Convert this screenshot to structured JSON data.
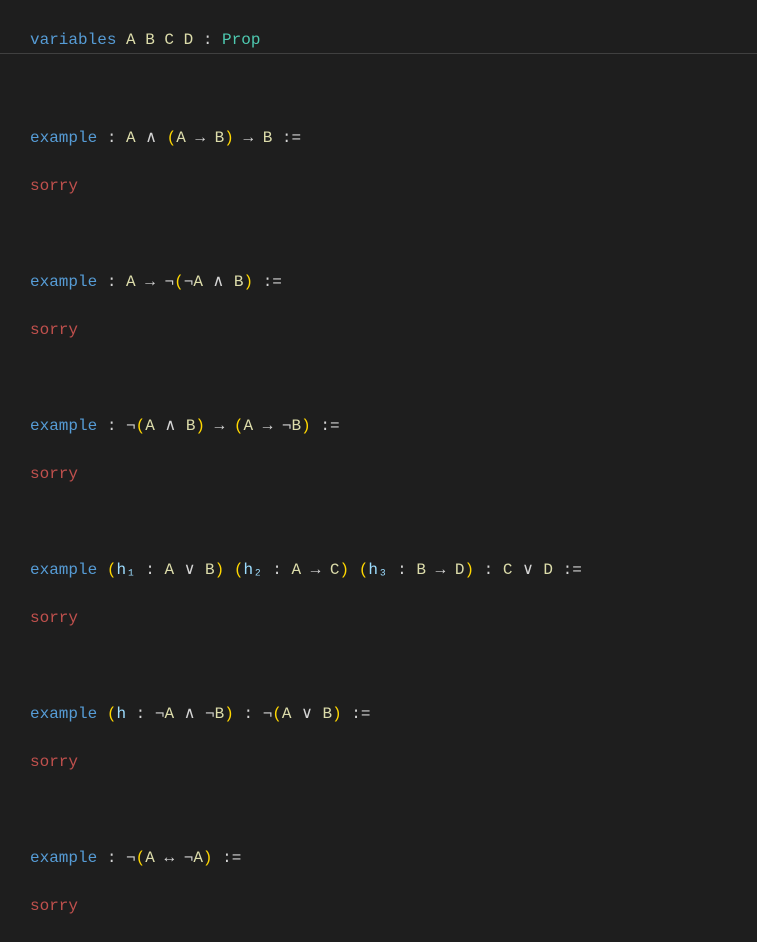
{
  "line1": {
    "variables": "variables",
    "idents": " A B C D ",
    "colon": ": ",
    "prop": "Prop"
  },
  "line3": {
    "example": "example",
    "ws1": " ",
    "colon1": ":",
    "ws2": " ",
    "ident1": "A",
    "ws3": " ",
    "op1": "∧",
    "ws4": " ",
    "lp1": "(",
    "ident2": "A",
    "ws5": " ",
    "op2": "→",
    "ws6": " ",
    "ident3": "B",
    "rp1": ")",
    "ws7": " ",
    "op3": "→",
    "ws8": " ",
    "ident4": "B",
    "ws9": " ",
    "assign": ":="
  },
  "sorry": "sorry",
  "line6": {
    "example": "example",
    "ws1": " ",
    "colon1": ":",
    "ws2": " ",
    "ident1": "A",
    "ws3": " ",
    "op1": "→",
    "ws4": " ",
    "neg": "¬",
    "lp1": "(",
    "neg2": "¬",
    "ident2": "A",
    "ws5": " ",
    "op2": "∧",
    "ws6": " ",
    "ident3": "B",
    "rp1": ")",
    "ws7": " ",
    "assign": ":="
  },
  "line9": {
    "example": "example",
    "ws1": " ",
    "colon1": ":",
    "ws2": " ",
    "neg1": "¬",
    "lp1": "(",
    "ident1": "A",
    "ws3": " ",
    "op1": "∧",
    "ws4": " ",
    "ident2": "B",
    "rp1": ")",
    "ws5": " ",
    "op2": "→",
    "ws6": " ",
    "lp2": "(",
    "ident3": "A",
    "ws7": " ",
    "op3": "→",
    "ws8": " ",
    "neg2": "¬",
    "ident4": "B",
    "rp2": ")",
    "ws9": " ",
    "assign": ":="
  },
  "line12": {
    "example": "example",
    "ws1": " ",
    "lp1": "(",
    "h1": "h₁",
    "ws2": " ",
    "colon1": ":",
    "ws3": " ",
    "ident1": "A",
    "ws4": " ",
    "op1": "∨",
    "ws5": " ",
    "ident2": "B",
    "rp1": ")",
    "ws6": " ",
    "lp2": "(",
    "h2": "h₂",
    "ws7": " ",
    "colon2": ":",
    "ws8": " ",
    "ident3": "A",
    "ws9": " ",
    "op2": "→",
    "ws10": " ",
    "ident4": "C",
    "rp2": ")",
    "ws11": " ",
    "lp3": "(",
    "h3": "h₃",
    "ws12": " ",
    "colon3": ":",
    "ws13": " ",
    "ident5": "B",
    "ws14": " ",
    "op3": "→",
    "ws15": " ",
    "ident6": "D",
    "rp3": ")",
    "ws16": " ",
    "colon4": ":",
    "ws17": " ",
    "ident7": "C",
    "ws18": " ",
    "op4": "∨",
    "ws19": " ",
    "ident8": "D",
    "ws20": " ",
    "assign": ":="
  },
  "line15": {
    "example": "example",
    "ws1": " ",
    "lp1": "(",
    "h1": "h",
    "ws2": " ",
    "colon1": ":",
    "ws3": " ",
    "neg1": "¬",
    "ident1": "A",
    "ws4": " ",
    "op1": "∧",
    "ws5": " ",
    "neg2": "¬",
    "ident2": "B",
    "rp1": ")",
    "ws6": " ",
    "colon2": ":",
    "ws7": " ",
    "neg3": "¬",
    "lp2": "(",
    "ident3": "A",
    "ws8": " ",
    "op2": "∨",
    "ws9": " ",
    "ident4": "B",
    "rp2": ")",
    "ws10": " ",
    "assign": ":="
  },
  "line18": {
    "example": "example",
    "ws1": " ",
    "colon1": ":",
    "ws2": " ",
    "neg1": "¬",
    "lp1": "(",
    "ident1": "A",
    "ws3": " ",
    "op1": "↔",
    "ws4": " ",
    "neg2": "¬",
    "ident2": "A",
    "rp1": ")",
    "ws5": " ",
    "assign": ":="
  }
}
